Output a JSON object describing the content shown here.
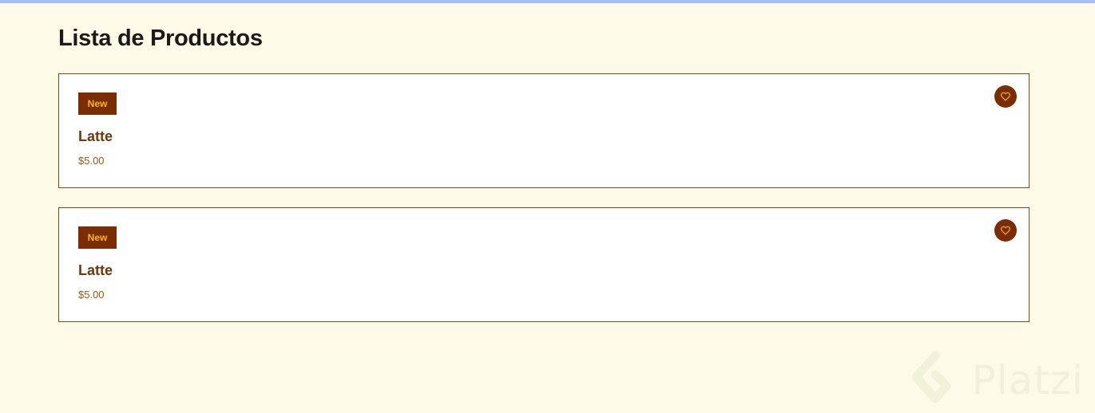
{
  "page": {
    "title": "Lista de Productos",
    "top_bar_color": "#a9bdf6",
    "background_color": "#fefae8"
  },
  "products": [
    {
      "badge": "New",
      "name": "Latte",
      "price": "$5.00",
      "favorite_icon": "heart-icon"
    },
    {
      "badge": "New",
      "name": "Latte",
      "price": "$5.00",
      "favorite_icon": "heart-icon"
    }
  ],
  "colors": {
    "badge_bg": "#7a2e00",
    "badge_text": "#ffb11f",
    "card_border": "#7a4a12",
    "name_text": "#6b3a10",
    "price_text": "#9a5a1a"
  },
  "watermark": {
    "text": "Platzi",
    "icon": "platzi-logo-icon"
  }
}
